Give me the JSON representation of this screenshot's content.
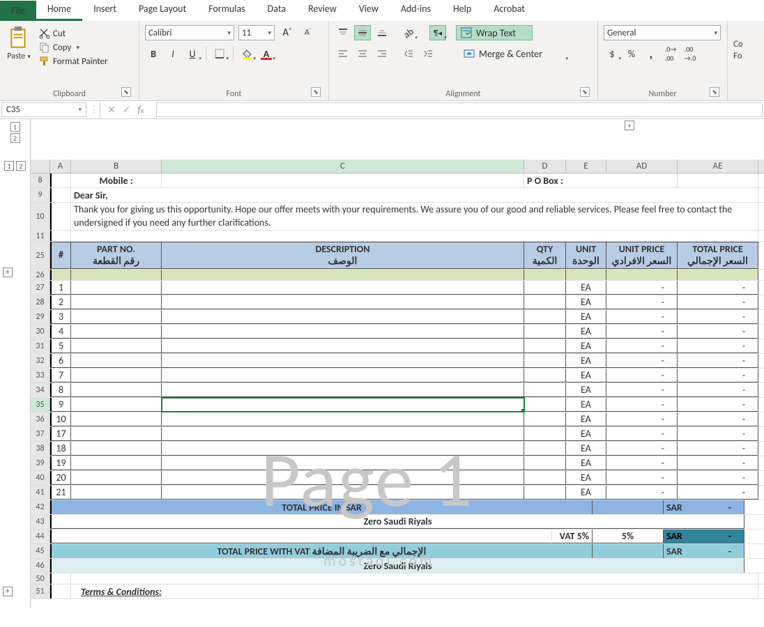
{
  "tabs": {
    "file": "File",
    "list": [
      "Home",
      "Insert",
      "Page Layout",
      "Formulas",
      "Data",
      "Review",
      "View",
      "Add-ins",
      "Help",
      "Acrobat"
    ],
    "active": "Home"
  },
  "ribbon": {
    "clipboard": {
      "paste": "Paste",
      "cut": "Cut",
      "copy": "Copy",
      "fmt": "Format Painter",
      "label": "Clipboard"
    },
    "font": {
      "name": "Calibri",
      "size": "11",
      "bold": "B",
      "italic": "I",
      "underline": "U",
      "label": "Font",
      "incFont": "A",
      "decFont": "A"
    },
    "alignment": {
      "wrap": "Wrap Text",
      "merge": "Merge & Center",
      "label": "Alignment"
    },
    "number": {
      "format": "General",
      "label": "Number",
      "currency": "$",
      "percent": "%",
      "comma": ",",
      "inc": ".00",
      "dec": ".00"
    },
    "cond": {
      "c1": "Co",
      "c2": "Fo"
    }
  },
  "nameBox": "C35",
  "columns": [
    "A",
    "B",
    "C",
    "D",
    "E",
    "AD",
    "AE"
  ],
  "outline": {
    "top": [
      "1",
      "2"
    ],
    "side": [
      "1",
      "2"
    ]
  },
  "rows8": {
    "mobile": "Mobile :",
    "pobox": "P O Box :"
  },
  "rows9": "Dear Sir,",
  "rows10": "Thank you for giving us this opportunity. Hope our offer meets with your requirements. We assure you of our good and reliable services. Please feel free to contact the undersigned if you need any further clarifications.",
  "headers": {
    "num": "#",
    "part_en": "PART NO.",
    "part_ar": "رقم القطعة",
    "desc_en": "DESCRIPTION",
    "desc_ar": "الوصف",
    "qty_en": "QTY",
    "qty_ar": "الكمية",
    "unit_en": "UNIT",
    "unit_ar": "الوحدة",
    "up_en": "UNIT PRICE",
    "up_ar": "السعر الافرادي",
    "tp_en": "TOTAL PRICE",
    "tp_ar": "السعر الإجمالي"
  },
  "itemRows": [
    {
      "r": 27,
      "n": "1",
      "unit": "EA",
      "up": "-",
      "tp": "-"
    },
    {
      "r": 28,
      "n": "2",
      "unit": "EA",
      "up": "-",
      "tp": "-"
    },
    {
      "r": 29,
      "n": "3",
      "unit": "EA",
      "up": "-",
      "tp": "-"
    },
    {
      "r": 30,
      "n": "4",
      "unit": "EA",
      "up": "-",
      "tp": "-"
    },
    {
      "r": 31,
      "n": "5",
      "unit": "EA",
      "up": "-",
      "tp": "-"
    },
    {
      "r": 32,
      "n": "6",
      "unit": "EA",
      "up": "-",
      "tp": "-"
    },
    {
      "r": 33,
      "n": "7",
      "unit": "EA",
      "up": "-",
      "tp": "-"
    },
    {
      "r": 34,
      "n": "8",
      "unit": "EA",
      "up": "-",
      "tp": "-"
    },
    {
      "r": 35,
      "n": "9",
      "unit": "EA",
      "up": "-",
      "tp": "-"
    },
    {
      "r": 36,
      "n": "10",
      "unit": "EA",
      "up": "-",
      "tp": "-"
    },
    {
      "r": 37,
      "n": "17",
      "unit": "EA",
      "up": "-",
      "tp": "-"
    },
    {
      "r": 38,
      "n": "18",
      "unit": "EA",
      "up": "-",
      "tp": "-"
    },
    {
      "r": 39,
      "n": "19",
      "unit": "EA",
      "up": "-",
      "tp": "-"
    },
    {
      "r": 40,
      "n": "20",
      "unit": "EA",
      "up": "-",
      "tp": "-"
    },
    {
      "r": 41,
      "n": "21",
      "unit": "EA",
      "up": "-",
      "tp": "-"
    }
  ],
  "totals": {
    "r42": {
      "r": 42,
      "label": "TOTAL PRICE IN SAR",
      "sar": "SAR",
      "dash": "-"
    },
    "r43": {
      "r": 43,
      "label": "Zero Saudi Riyals"
    },
    "r44": {
      "r": 44,
      "vatlbl": "VAT 5%",
      "vatpct": "5%",
      "sar": "SAR",
      "dash": "-"
    },
    "r45": {
      "r": 45,
      "label": "TOTAL PRICE WITH VAT الإجمالي مع الضريبة المضافة",
      "sar": "SAR",
      "dash": "-"
    },
    "r46": {
      "r": 46,
      "label": "Zero Saudi Riyals"
    }
  },
  "r50": 50,
  "r51": {
    "r": 51,
    "label": "Terms & Conditions:"
  },
  "watermark": "Page 1",
  "wm2": "mostaql.com",
  "rowHdrsMisc": {
    "r8": 8,
    "r9": 9,
    "r10": 10,
    "r11": 11,
    "r25": 25,
    "r26": 26
  }
}
